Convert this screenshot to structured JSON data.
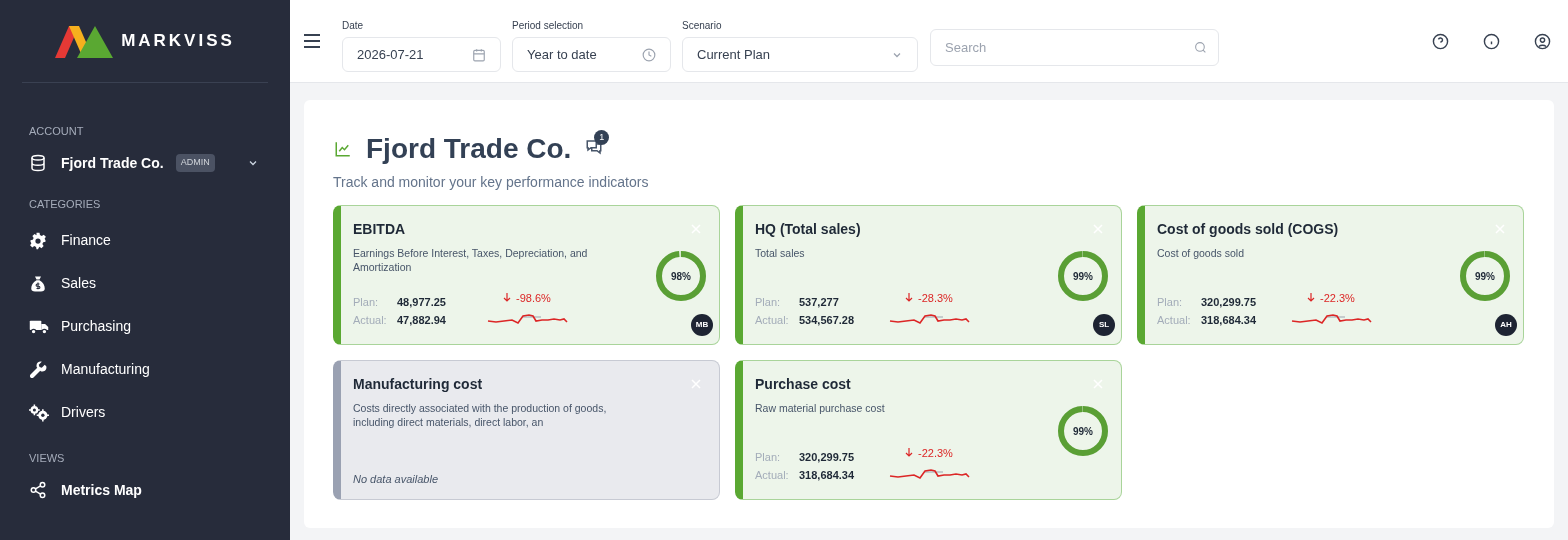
{
  "sidebar": {
    "brand": "MARKVISS",
    "sections": [
      {
        "heading": "ACCOUNT",
        "items": [
          {
            "kind": "account",
            "label": "Fjord Trade Co.",
            "badge": "ADMIN"
          }
        ]
      },
      {
        "heading": "CATEGORIES",
        "items": [
          {
            "kind": "link",
            "label": "Finance"
          },
          {
            "kind": "link",
            "label": "Sales"
          },
          {
            "kind": "link",
            "label": "Purchasing"
          },
          {
            "kind": "link",
            "label": "Manufacturing"
          },
          {
            "kind": "link",
            "label": "Drivers"
          }
        ]
      },
      {
        "heading": "VIEWS",
        "items": [
          {
            "kind": "view",
            "label": "Metrics Map"
          }
        ]
      }
    ]
  },
  "toolbar": {
    "filters": [
      {
        "label": "Date",
        "value": "2026-07-21"
      },
      {
        "label": "Period selection",
        "value": "Year to date"
      },
      {
        "label": "Scenario",
        "value": "Current Plan"
      }
    ],
    "search": {
      "placeholder": "Search"
    }
  },
  "page": {
    "title": "Fjord Trade Co.",
    "comment_count": "1",
    "subtitle": "Track and monitor your key performance indicators"
  },
  "cards": [
    {
      "kind": "metric",
      "title": "EBITDA",
      "description": "Earnings Before Interest, Taxes, Depreciation, and Amortization",
      "plan_label": "Plan:",
      "plan": "48,977.25",
      "actual_label": "Actual:",
      "actual": "47,882.94",
      "change": "-98.6%",
      "score": "98%",
      "level": 0.98,
      "owner": "MB"
    },
    {
      "kind": "metric",
      "title": "HQ (Total sales)",
      "description": "Total sales",
      "plan_label": "Plan:",
      "plan": "537,277",
      "actual_label": "Actual:",
      "actual": "534,567.28",
      "change": "-28.3%",
      "score": "99%",
      "level": 0.99,
      "owner": "SL"
    },
    {
      "kind": "metric",
      "title": "Cost of goods sold (COGS)",
      "description": "Cost of goods sold",
      "plan_label": "Plan:",
      "plan": "320,299.75",
      "actual_label": "Actual:",
      "actual": "318,684.34",
      "change": "-22.3%",
      "score": "99%",
      "level": 0.99,
      "owner": "AH"
    },
    {
      "kind": "empty",
      "title": "Manufacturing cost",
      "description": "Costs directly associated with the production of goods, including direct materials, direct labor, an",
      "note": "No data available"
    },
    {
      "kind": "metric",
      "title": "Purchase cost",
      "description": "Raw material purchase cost",
      "plan_label": "Plan:",
      "plan": "320,299.75",
      "actual_label": "Actual:",
      "actual": "318,684.34",
      "change": "-22.3%",
      "score": "99%",
      "level": 0.99
    }
  ]
}
